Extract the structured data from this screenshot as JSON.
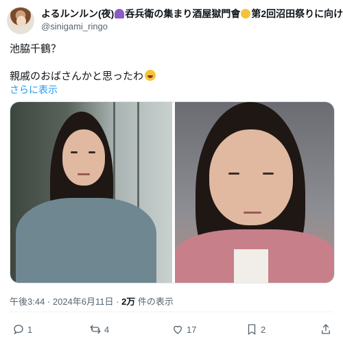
{
  "post": {
    "author": {
      "display_name": "よるルンルン(夜)",
      "display_name_suffix": "呑兵衛の集まり酒屋獄門會",
      "display_name_tail": "第2回沼田祭りに向けて",
      "handle": "@sinigami_ringo",
      "emojis": [
        "umbrella-icon",
        "grinning-face-icon"
      ]
    },
    "text_line1": "池脇千鶴？",
    "text_line2": "親戚のおばさんかと思ったわ",
    "text_emoji": "rolling-on-floor-laughing-icon",
    "show_more": "さらに表示",
    "media_count": 2,
    "timestamp": "午後3:44 · 2024年6月11日 · ",
    "views_count": "2万",
    "views_label": " 件の表示"
  },
  "actions": {
    "reply_count": "1",
    "repost_count": "4",
    "like_count": "17",
    "bookmark_count": "2"
  },
  "colors": {
    "link": "#1d9bf0",
    "secondary_text": "#536471",
    "primary_text": "#0f1419",
    "divider": "#eff3f4"
  }
}
